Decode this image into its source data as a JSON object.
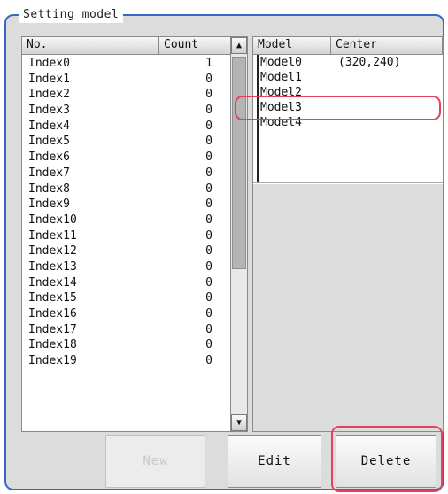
{
  "group": {
    "title": "Setting model"
  },
  "index_table": {
    "columns": [
      "No.",
      "Count"
    ],
    "rows": [
      {
        "no": "Index0",
        "count": "1"
      },
      {
        "no": "Index1",
        "count": "0"
      },
      {
        "no": "Index2",
        "count": "0"
      },
      {
        "no": "Index3",
        "count": "0"
      },
      {
        "no": "Index4",
        "count": "0"
      },
      {
        "no": "Index5",
        "count": "0"
      },
      {
        "no": "Index6",
        "count": "0"
      },
      {
        "no": "Index7",
        "count": "0"
      },
      {
        "no": "Index8",
        "count": "0"
      },
      {
        "no": "Index9",
        "count": "0"
      },
      {
        "no": "Index10",
        "count": "0"
      },
      {
        "no": "Index11",
        "count": "0"
      },
      {
        "no": "Index12",
        "count": "0"
      },
      {
        "no": "Index13",
        "count": "0"
      },
      {
        "no": "Index14",
        "count": "0"
      },
      {
        "no": "Index15",
        "count": "0"
      },
      {
        "no": "Index16",
        "count": "0"
      },
      {
        "no": "Index17",
        "count": "0"
      },
      {
        "no": "Index18",
        "count": "0"
      },
      {
        "no": "Index19",
        "count": "0"
      }
    ],
    "scroll_up_icon": "▲",
    "scroll_down_icon": "▼"
  },
  "model_table": {
    "columns": [
      "Model",
      "Center"
    ],
    "rows": [
      {
        "model": "Model0",
        "center": "(320,240)"
      },
      {
        "model": "Model1",
        "center": ""
      },
      {
        "model": "Model2",
        "center": ""
      },
      {
        "model": "Model3",
        "center": ""
      },
      {
        "model": "Model4",
        "center": ""
      }
    ]
  },
  "buttons": {
    "new": "New",
    "edit": "Edit",
    "delete": "Delete"
  },
  "colors": {
    "group_border": "#3a67c7",
    "highlight": "#e0435a",
    "panel": "#dcdcdc"
  }
}
